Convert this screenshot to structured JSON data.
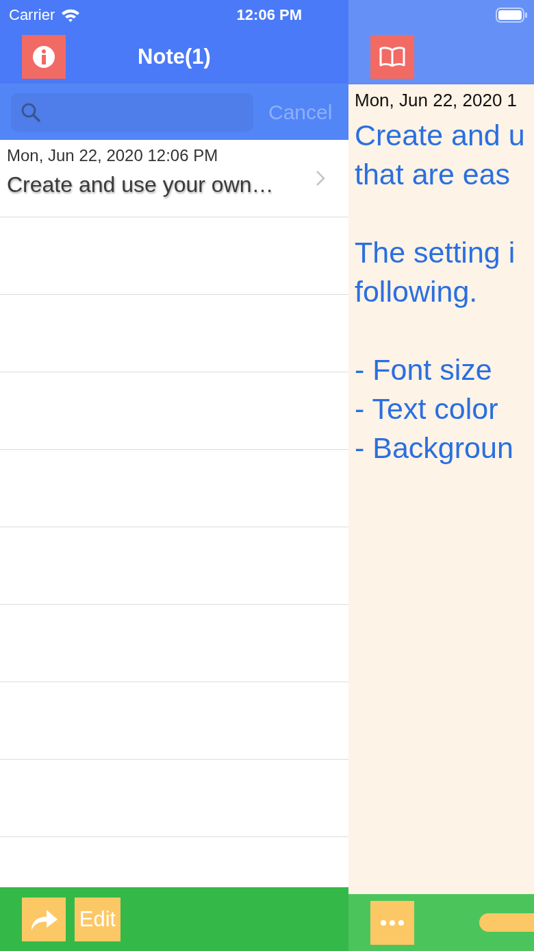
{
  "status_bar": {
    "carrier": "Carrier",
    "time": "12:06 PM"
  },
  "list_pane": {
    "title": "Note(1)",
    "search": {
      "cancel": "Cancel"
    },
    "notes": [
      {
        "date": "Mon, Jun 22, 2020 12:06 PM",
        "title": "Create and use your own…"
      }
    ],
    "toolbar": {
      "edit": "Edit"
    }
  },
  "detail_pane": {
    "date": "Mon, Jun 22, 2020 1",
    "paragraphs": [
      [
        "Create and u",
        "that are eas"
      ],
      [
        "The setting i",
        "following."
      ],
      [
        "- Font size",
        "- Text color",
        "- Backgroun"
      ]
    ]
  }
}
